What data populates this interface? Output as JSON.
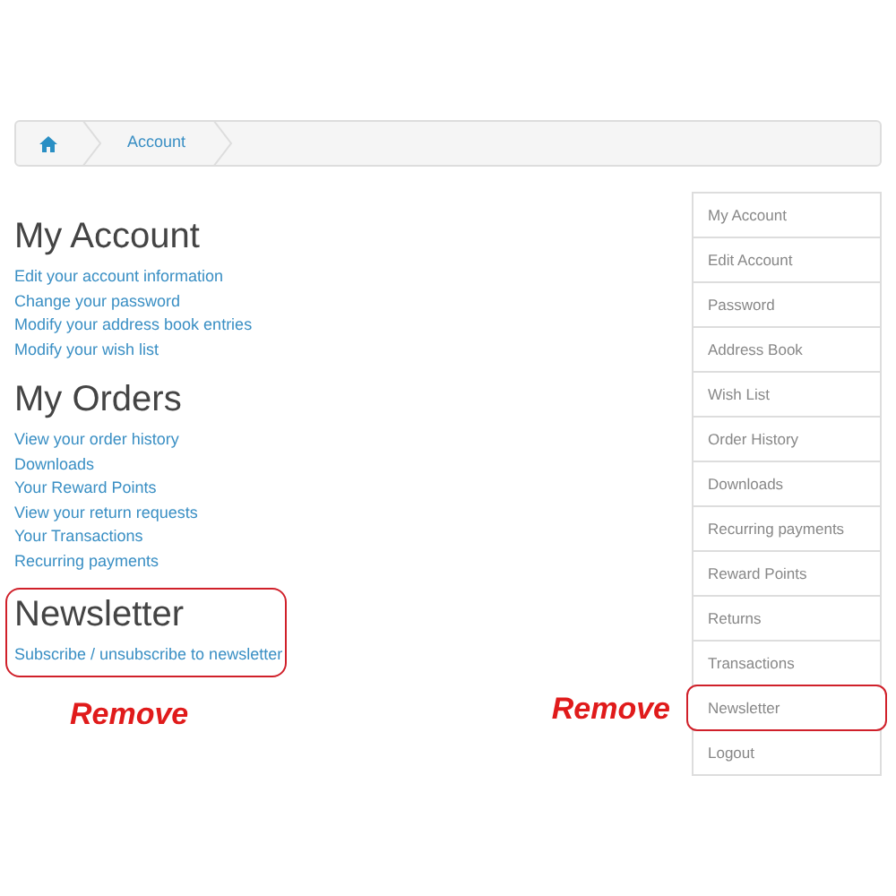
{
  "breadcrumb": [
    {
      "kind": "home"
    },
    {
      "kind": "text",
      "label": "Account"
    }
  ],
  "sections": [
    {
      "title": "My Account",
      "highlighted": false,
      "links": [
        "Edit your account information",
        "Change your password",
        "Modify your address book entries",
        "Modify your wish list"
      ]
    },
    {
      "title": "My Orders",
      "highlighted": false,
      "links": [
        "View your order history",
        "Downloads",
        "Your Reward Points",
        "View your return requests",
        "Your Transactions",
        "Recurring payments"
      ]
    },
    {
      "title": "Newsletter",
      "highlighted": true,
      "links": [
        "Subscribe / unsubscribe to newsletter"
      ],
      "note": "Remove"
    }
  ],
  "sidebar": {
    "items": [
      {
        "label": "My Account",
        "highlighted": false
      },
      {
        "label": "Edit Account",
        "highlighted": false
      },
      {
        "label": "Password",
        "highlighted": false
      },
      {
        "label": "Address Book",
        "highlighted": false
      },
      {
        "label": "Wish List",
        "highlighted": false
      },
      {
        "label": "Order History",
        "highlighted": false
      },
      {
        "label": "Downloads",
        "highlighted": false
      },
      {
        "label": "Recurring payments",
        "highlighted": false
      },
      {
        "label": "Reward Points",
        "highlighted": false
      },
      {
        "label": "Returns",
        "highlighted": false
      },
      {
        "label": "Transactions",
        "highlighted": false
      },
      {
        "label": "Newsletter",
        "highlighted": true,
        "note": "Remove"
      },
      {
        "label": "Logout",
        "highlighted": false
      }
    ]
  }
}
